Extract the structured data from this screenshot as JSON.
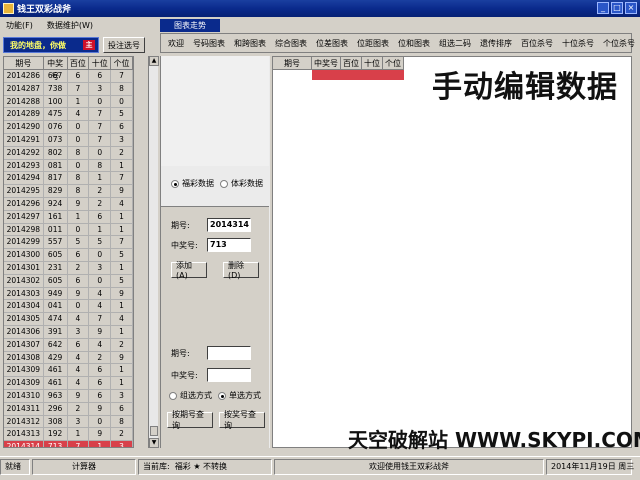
{
  "window": {
    "title": "钱王双彩战斧",
    "buttons": [
      "_",
      "□",
      "×"
    ]
  },
  "menu": [
    "功能(F)",
    "数据维护(W)"
  ],
  "left_toolbar": {
    "lucky_label": "我的地盘，你做",
    "lucky_badge": "主",
    "bet_button": "投注选号"
  },
  "grid": {
    "headers": [
      "期号",
      "中奖号",
      "百位",
      "十位",
      "个位"
    ],
    "rows": [
      [
        "2014286",
        "667",
        "6",
        "6",
        "7"
      ],
      [
        "2014287",
        "738",
        "7",
        "3",
        "8"
      ],
      [
        "2014288",
        "100",
        "1",
        "0",
        "0"
      ],
      [
        "2014289",
        "475",
        "4",
        "7",
        "5"
      ],
      [
        "2014290",
        "076",
        "0",
        "7",
        "6"
      ],
      [
        "2014291",
        "073",
        "0",
        "7",
        "3"
      ],
      [
        "2014292",
        "802",
        "8",
        "0",
        "2"
      ],
      [
        "2014293",
        "081",
        "0",
        "8",
        "1"
      ],
      [
        "2014294",
        "817",
        "8",
        "1",
        "7"
      ],
      [
        "2014295",
        "829",
        "8",
        "2",
        "9"
      ],
      [
        "2014296",
        "924",
        "9",
        "2",
        "4"
      ],
      [
        "2014297",
        "161",
        "1",
        "6",
        "1"
      ],
      [
        "2014298",
        "011",
        "0",
        "1",
        "1"
      ],
      [
        "2014299",
        "557",
        "5",
        "5",
        "7"
      ],
      [
        "2014300",
        "605",
        "6",
        "0",
        "5"
      ],
      [
        "2014301",
        "231",
        "2",
        "3",
        "1"
      ],
      [
        "2014302",
        "605",
        "6",
        "0",
        "5"
      ],
      [
        "2014303",
        "949",
        "9",
        "4",
        "9"
      ],
      [
        "2014304",
        "041",
        "0",
        "4",
        "1"
      ],
      [
        "2014305",
        "474",
        "4",
        "7",
        "4"
      ],
      [
        "2014306",
        "391",
        "3",
        "9",
        "1"
      ],
      [
        "2014307",
        "642",
        "6",
        "4",
        "2"
      ],
      [
        "2014308",
        "429",
        "4",
        "2",
        "9"
      ],
      [
        "2014309",
        "461",
        "4",
        "6",
        "1"
      ],
      [
        "2014309",
        "461",
        "4",
        "6",
        "1"
      ],
      [
        "2014310",
        "963",
        "9",
        "6",
        "3"
      ],
      [
        "2014311",
        "296",
        "2",
        "9",
        "6"
      ],
      [
        "2014312",
        "308",
        "3",
        "0",
        "8"
      ],
      [
        "2014313",
        "192",
        "1",
        "9",
        "2"
      ],
      [
        "2014314",
        "713",
        "7",
        "1",
        "3"
      ]
    ]
  },
  "tab_header": "图表走势",
  "tabs": [
    "欢迎",
    "号码图表",
    "和跨图表",
    "综合图表",
    "位差图表",
    "位距图表",
    "位和图表",
    "组选二码",
    "遗传排序",
    "百位杀号",
    "十位杀号",
    "个位杀号"
  ],
  "right_grid": {
    "headers": [
      "期号",
      "中奖号",
      "百位",
      "十位",
      "个位"
    ]
  },
  "mid": {
    "radio_fc": "福彩数据",
    "radio_tc": "体彩数据",
    "period_label": "期号:",
    "period_value": "2014314",
    "winning_label": "中奖号:",
    "winning_value": "713",
    "add_button": "添加(A)",
    "delete_button": "删除(D)",
    "q_period_label": "期号:",
    "q_winning_label": "中奖号:",
    "radio_group": "组选方式",
    "radio_single": "单选方式",
    "query_period_button": "按期号查询",
    "query_winning_button": "按奖号查询"
  },
  "watermark_top": "手动编辑数据",
  "watermark_bottom": "天空破解站 WWW.SKYPI.COM",
  "status": {
    "ready": "就绪",
    "calculator": "计算器",
    "current_db": "当前库:",
    "lottery": "福彩 ★ 不转换",
    "welcome": "欢迎使用钱王双彩战斧",
    "date": "2014年11月19日 周三"
  }
}
